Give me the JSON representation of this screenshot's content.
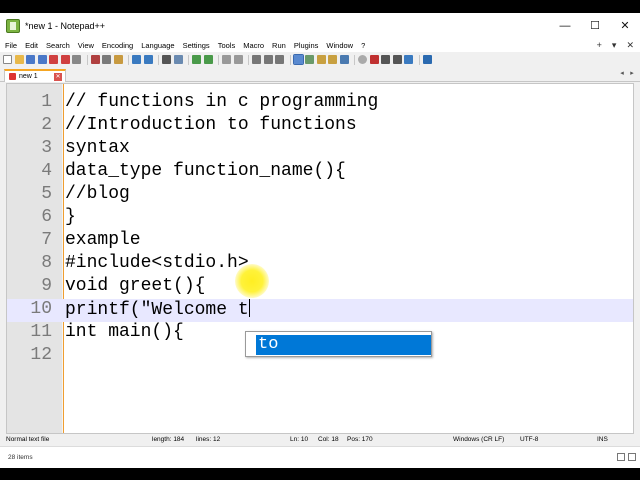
{
  "window": {
    "title": "*new 1 - Notepad++",
    "minimize": "—",
    "maximize": "☐",
    "close": "✕"
  },
  "menu": {
    "items": [
      "File",
      "Edit",
      "Search",
      "View",
      "Encoding",
      "Language",
      "Settings",
      "Tools",
      "Macro",
      "Run",
      "Plugins",
      "Window",
      "?"
    ],
    "right": [
      "+",
      "▾",
      "✕"
    ]
  },
  "tab": {
    "label": "new 1",
    "close": "✕"
  },
  "editor": {
    "lines": [
      {
        "num": "1",
        "text": "// functions in c programming"
      },
      {
        "num": "2",
        "text": "//Introduction to functions"
      },
      {
        "num": "3",
        "text": "syntax"
      },
      {
        "num": "4",
        "text": "data_type function_name(){"
      },
      {
        "num": "5",
        "text": "//blog"
      },
      {
        "num": "6",
        "text": "}"
      },
      {
        "num": "7",
        "text": "example"
      },
      {
        "num": "8",
        "text": "#include<stdio.h>"
      },
      {
        "num": "9",
        "text": "void greet(){"
      },
      {
        "num": "10",
        "text": "printf(\"Welcome t"
      },
      {
        "num": "11",
        "text": "int main(){"
      },
      {
        "num": "12",
        "text": ""
      }
    ],
    "active_line": 10,
    "autocomplete": "to"
  },
  "status": {
    "filetype": "Normal text file",
    "length": "length: 184",
    "lines": "lines: 12",
    "ln": "Ln: 10",
    "col": "Col: 18",
    "pos": "Pos: 170",
    "eol": "Windows (CR LF)",
    "encoding": "UTF-8",
    "mode": "INS"
  },
  "explorer": {
    "items": "28 items"
  },
  "colors": {
    "accent": "#0078d7",
    "tab_indicator": "#f5a623",
    "active_line": "#e8e8ff"
  }
}
